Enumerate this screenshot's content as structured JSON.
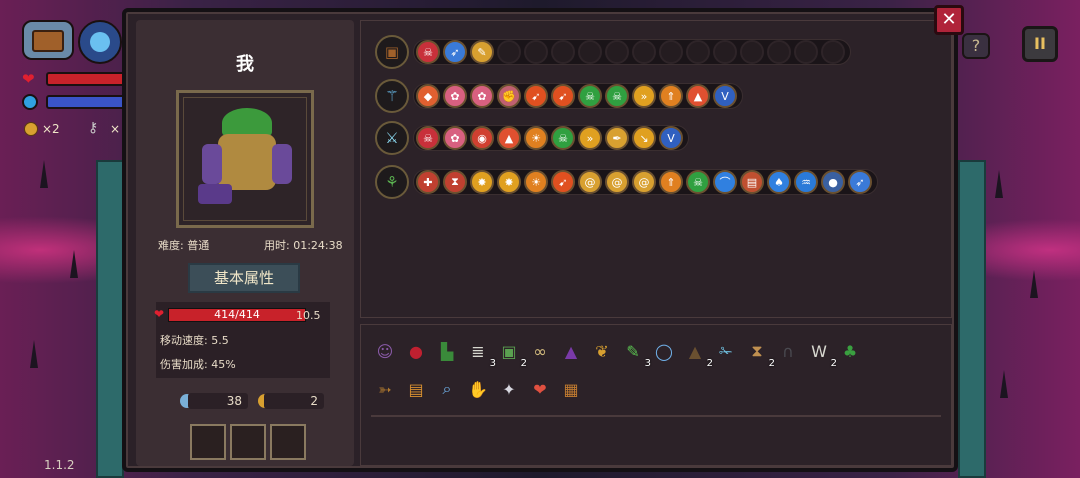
{
  "hud": {
    "coins": "×2",
    "key_label": "×"
  },
  "panel": {
    "title": "我",
    "difficulty": "难度: 普通",
    "time": "用时: 01:24:38",
    "section_title": "基本属性",
    "hp": "414/414",
    "hp_extra": "10.5",
    "hp_fraction": 1.0,
    "move_speed": "移动速度: 5.5",
    "damage_bonus": "伤害加成: 45%",
    "keys": "38",
    "coins": "2",
    "close_label": "✕"
  },
  "weapons": [
    {
      "name": "chest",
      "icon": "chest",
      "upgrades": [
        "skull-red",
        "arrow-blue",
        "feather-gold"
      ],
      "empty": 13
    },
    {
      "name": "staff",
      "icon": "staff",
      "upgrades": [
        "gem",
        "flower",
        "flower",
        "fist",
        "carrot",
        "carrot",
        "skull-green",
        "skull-green",
        "chevrons",
        "arrows-up",
        "tri",
        "wing-blue"
      ],
      "empty": 0
    },
    {
      "name": "sword",
      "icon": "sword",
      "upgrades": [
        "skull-red",
        "flower",
        "pill",
        "tri",
        "sun",
        "skull-green",
        "chevrons",
        "feather",
        "bolt",
        "wing-blue"
      ],
      "empty": 0
    },
    {
      "name": "wand",
      "icon": "wand",
      "upgrades": [
        "cross",
        "hourglass",
        "burst",
        "burst",
        "sun",
        "carrot",
        "swirl",
        "swirl",
        "swirl",
        "arrows-up",
        "skull-green",
        "hook",
        "jar",
        "mushroom",
        "jellyfish",
        "orb",
        "arrow-blue"
      ],
      "empty": 0
    }
  ],
  "items": {
    "row1": [
      {
        "icon": "witch-face",
        "count": ""
      },
      {
        "icon": "red-egg",
        "count": ""
      },
      {
        "icon": "green-boot",
        "count": ""
      },
      {
        "icon": "ribcage",
        "count": "3"
      },
      {
        "icon": "green-cube",
        "count": "2"
      },
      {
        "icon": "glasses",
        "count": ""
      },
      {
        "icon": "wizard-hat",
        "count": ""
      },
      {
        "icon": "gold-wings",
        "count": ""
      },
      {
        "icon": "syringe",
        "count": "3"
      },
      {
        "icon": "mirror",
        "count": ""
      },
      {
        "icon": "cape",
        "count": "2"
      },
      {
        "icon": "wrench",
        "count": ""
      },
      {
        "icon": "hourglass",
        "count": "2"
      },
      {
        "icon": "tombstone",
        "count": ""
      },
      {
        "icon": "fangs",
        "count": "2"
      },
      {
        "icon": "clover",
        "count": ""
      }
    ],
    "row2": [
      {
        "icon": "arrow-bow",
        "count": ""
      },
      {
        "icon": "scroll",
        "count": ""
      },
      {
        "icon": "magnifier",
        "count": ""
      },
      {
        "icon": "blue-glove",
        "count": ""
      },
      {
        "icon": "crystal-shard",
        "count": ""
      },
      {
        "icon": "heart",
        "count": ""
      },
      {
        "icon": "bracer",
        "count": ""
      }
    ]
  },
  "version": "1.1.2",
  "colors": {
    "accent": "#b0243a",
    "panel": "#2b2128",
    "hp": "#c8222a"
  }
}
